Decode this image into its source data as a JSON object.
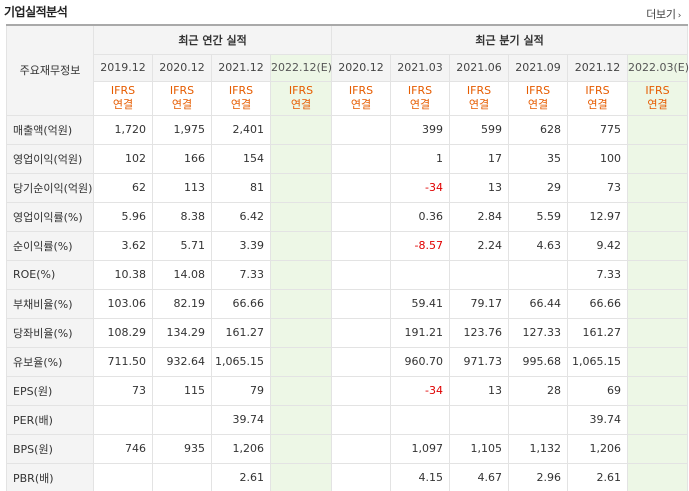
{
  "title": "기업실적분석",
  "more_label": "더보기",
  "corner_label": "주요재무정보",
  "group_annual": "최근 연간 실적",
  "group_quarterly": "최근 분기 실적",
  "annual_periods": [
    "2019.12",
    "2020.12",
    "2021.12",
    "2022.12(E)"
  ],
  "quarter_periods": [
    "2020.12",
    "2021.03",
    "2021.06",
    "2021.09",
    "2021.12",
    "2022.03(E)"
  ],
  "basis_line1": "IFRS",
  "basis_line2": "연결",
  "rows": [
    {
      "label": "매출액(억원)",
      "annual": [
        "1,720",
        "1,975",
        "2,401",
        ""
      ],
      "quarter": [
        "",
        "399",
        "599",
        "628",
        "775",
        ""
      ]
    },
    {
      "label": "영업이익(억원)",
      "annual": [
        "102",
        "166",
        "154",
        ""
      ],
      "quarter": [
        "",
        "1",
        "17",
        "35",
        "100",
        ""
      ]
    },
    {
      "label": "당기순이익(억원)",
      "annual": [
        "62",
        "113",
        "81",
        ""
      ],
      "quarter": [
        "",
        "-34",
        "13",
        "29",
        "73",
        ""
      ]
    },
    {
      "label": "영업이익률(%)",
      "annual": [
        "5.96",
        "8.38",
        "6.42",
        ""
      ],
      "quarter": [
        "",
        "0.36",
        "2.84",
        "5.59",
        "12.97",
        ""
      ]
    },
    {
      "label": "순이익률(%)",
      "annual": [
        "3.62",
        "5.71",
        "3.39",
        ""
      ],
      "quarter": [
        "",
        "-8.57",
        "2.24",
        "4.63",
        "9.42",
        ""
      ]
    },
    {
      "label": "ROE(%)",
      "annual": [
        "10.38",
        "14.08",
        "7.33",
        ""
      ],
      "quarter": [
        "",
        "",
        "",
        "",
        "7.33",
        ""
      ]
    },
    {
      "label": "부채비율(%)",
      "annual": [
        "103.06",
        "82.19",
        "66.66",
        ""
      ],
      "quarter": [
        "",
        "59.41",
        "79.17",
        "66.44",
        "66.66",
        ""
      ]
    },
    {
      "label": "당좌비율(%)",
      "annual": [
        "108.29",
        "134.29",
        "161.27",
        ""
      ],
      "quarter": [
        "",
        "191.21",
        "123.76",
        "127.33",
        "161.27",
        ""
      ]
    },
    {
      "label": "유보율(%)",
      "annual": [
        "711.50",
        "932.64",
        "1,065.15",
        ""
      ],
      "quarter": [
        "",
        "960.70",
        "971.73",
        "995.68",
        "1,065.15",
        ""
      ]
    },
    {
      "label": "EPS(원)",
      "annual": [
        "73",
        "115",
        "79",
        ""
      ],
      "quarter": [
        "",
        "-34",
        "13",
        "28",
        "69",
        ""
      ]
    },
    {
      "label": "PER(배)",
      "annual": [
        "",
        "",
        "39.74",
        ""
      ],
      "quarter": [
        "",
        "",
        "",
        "",
        "39.74",
        ""
      ]
    },
    {
      "label": "BPS(원)",
      "annual": [
        "746",
        "935",
        "1,206",
        ""
      ],
      "quarter": [
        "",
        "1,097",
        "1,105",
        "1,132",
        "1,206",
        ""
      ]
    },
    {
      "label": "PBR(배)",
      "annual": [
        "",
        "",
        "2.61",
        ""
      ],
      "quarter": [
        "",
        "4.15",
        "4.67",
        "2.96",
        "2.61",
        ""
      ]
    }
  ],
  "colors": {
    "accent_orange": "#e65c00",
    "negative_red": "#e00000",
    "estimate_bg": "#edf7e6",
    "header_bg": "#f4f4f4"
  }
}
